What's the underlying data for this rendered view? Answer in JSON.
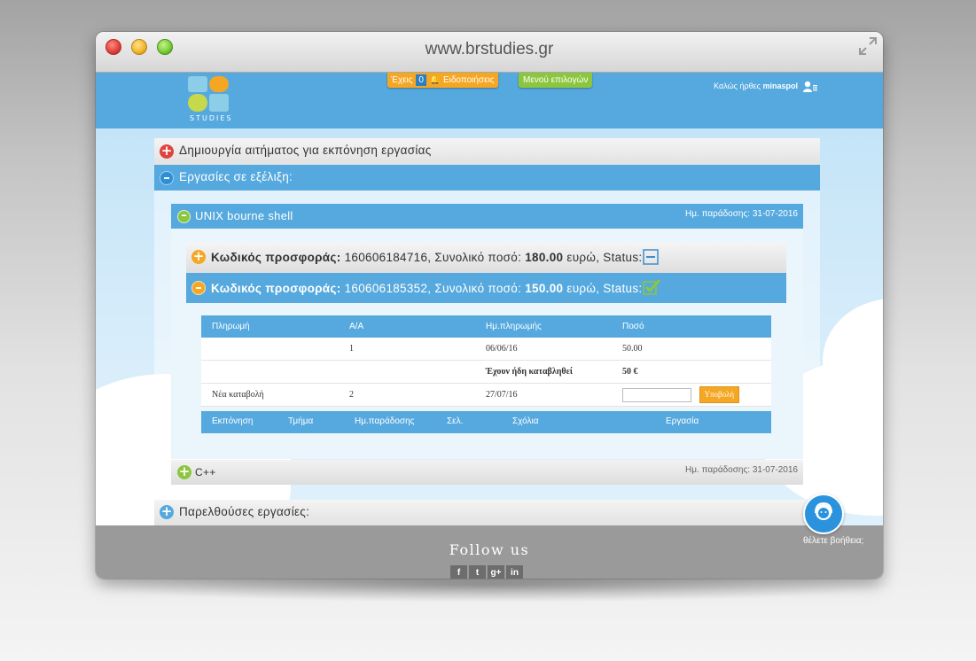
{
  "window": {
    "url": "www.brstudies.gr"
  },
  "header": {
    "logo_text": "STUDIES",
    "notifications": {
      "prefix": "Έχεις",
      "count": "0",
      "label": "Ειδοποιήσεις",
      "icon": "bell-icon"
    },
    "menu_label": "Μενού επιλογών",
    "welcome_text": "Καλώς ήρθες",
    "username": "minaspol",
    "user_icon": "user-menu-icon"
  },
  "sections": {
    "create_request": "Δημιουργία αιτήματος για εκπόνηση εργασίας",
    "in_progress": "Εργασίες σε εξέλιξη:",
    "past": "Παρελθούσες εργασίες:"
  },
  "tasks": [
    {
      "title": "UNIX bourne shell",
      "due": "Ημ. παράδοσης: 31-07-2016",
      "expanded": true,
      "offers": [
        {
          "label": "Κωδικός προσφοράς:",
          "code": "160606184716",
          "total_label": "Συνολικό ποσό:",
          "amount": "180.00",
          "currency": "ευρώ, Status:",
          "status": "pending"
        },
        {
          "label": "Κωδικός προσφοράς:",
          "code": "160606185352",
          "total_label": "Συνολικό ποσό:",
          "amount": "150.00",
          "currency": "ευρώ, Status:",
          "status": "accepted"
        }
      ],
      "payments": {
        "headers": [
          "Πληρωμή",
          "Α/Α",
          "Ημ.πληρωμής",
          "Ποσό"
        ],
        "rows": [
          {
            "col1": "",
            "aa": "1",
            "date": "06/06/16",
            "amount": "50.00"
          },
          {
            "col1": "",
            "aa": "",
            "date": "Έχουν ήδη καταβληθεί",
            "amount": "50 €"
          },
          {
            "col1": "Νέα καταβολή",
            "aa": "2",
            "date": "27/07/16",
            "amount": ""
          }
        ],
        "submit_label": "Υποβολή",
        "footer": [
          "Εκπόνηση",
          "Τμήμα",
          "Ημ.παράδοσης",
          "Σελ.",
          "Σχόλια",
          "Εργασία"
        ]
      }
    },
    {
      "title": "C++",
      "due": "Ημ. παράδοσης: 31-07-2016",
      "expanded": false
    }
  ],
  "footer": {
    "follow": "Follow us",
    "social": [
      "f",
      "t",
      "g+",
      "in"
    ],
    "help_text": "θέλετε βοήθεια;"
  },
  "colors": {
    "primary_blue": "#56a9de",
    "orange": "#f5a623",
    "green": "#8cc63f",
    "red": "#e0443e"
  }
}
